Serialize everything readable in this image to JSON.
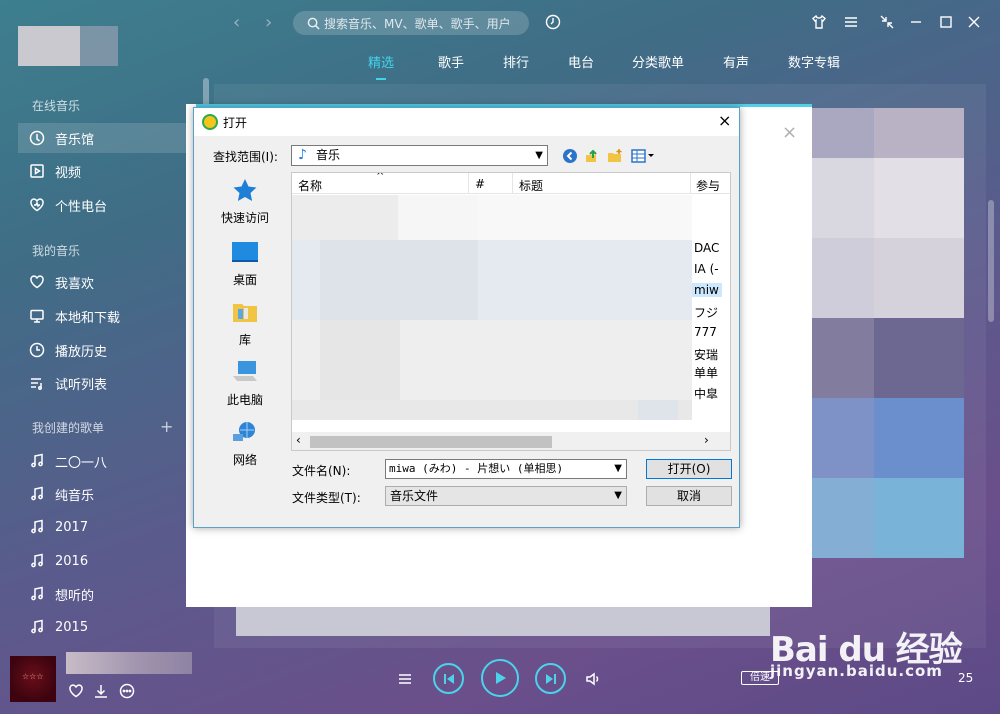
{
  "sidebar": {
    "sections": [
      {
        "title": "在线音乐"
      },
      {
        "title": "我的音乐"
      },
      {
        "title": "我创建的歌单"
      }
    ],
    "online": [
      {
        "label": "音乐馆"
      },
      {
        "label": "视频"
      },
      {
        "label": "个性电台"
      }
    ],
    "mine": [
      {
        "label": "我喜欢"
      },
      {
        "label": "本地和下载"
      },
      {
        "label": "播放历史"
      },
      {
        "label": "试听列表"
      }
    ],
    "playlists": [
      {
        "label": "二〇一八"
      },
      {
        "label": "纯音乐"
      },
      {
        "label": "2017"
      },
      {
        "label": "2016"
      },
      {
        "label": "想听的"
      },
      {
        "label": "2015"
      }
    ],
    "add_symbol": "+"
  },
  "topbar": {
    "search_placeholder": "搜索音乐、MV、歌单、歌手、用户",
    "back_arrow": "‹",
    "forward_arrow": "›",
    "tabs": [
      {
        "label": "精选"
      },
      {
        "label": "歌手"
      },
      {
        "label": "排行"
      },
      {
        "label": "电台"
      },
      {
        "label": "分类歌单"
      },
      {
        "label": "有声"
      },
      {
        "label": "数字专辑"
      }
    ]
  },
  "outer_dialog": {
    "close": "×"
  },
  "open_dialog": {
    "title": "打开",
    "close": "×",
    "look_in_label": "查找范围(I):",
    "look_in_value": "音乐",
    "places": [
      {
        "label": "快速访问"
      },
      {
        "label": "桌面"
      },
      {
        "label": "库"
      },
      {
        "label": "此电脑"
      },
      {
        "label": "网络"
      }
    ],
    "columns": {
      "name": "名称",
      "num": "#",
      "title": "标题",
      "artist": "参与"
    },
    "artists": [
      {
        "label": "DAC"
      },
      {
        "label": "IA (-"
      },
      {
        "label": "miw"
      },
      {
        "label": "フジ"
      },
      {
        "label": "777"
      },
      {
        "label": "安瑞"
      },
      {
        "label": "单单"
      },
      {
        "label": "中皐"
      }
    ],
    "file_name_label": "文件名(N):",
    "file_name_value": "miwa (みわ) - 片想い (单相思)",
    "file_type_label": "文件类型(T):",
    "file_type_value": "音乐文件",
    "open_button": "打开(O)",
    "cancel_button": "取消"
  },
  "player": {
    "cover_text": "☆☆☆",
    "rate_label": "倍速",
    "count": "25"
  },
  "watermark": {
    "brand": "Bai du 经验",
    "sub": "jingyan.baidu.com"
  },
  "colors": {
    "accent": "#42d3e8",
    "dialog_border": "#5aa0c9",
    "selection": "#cce8ff"
  }
}
